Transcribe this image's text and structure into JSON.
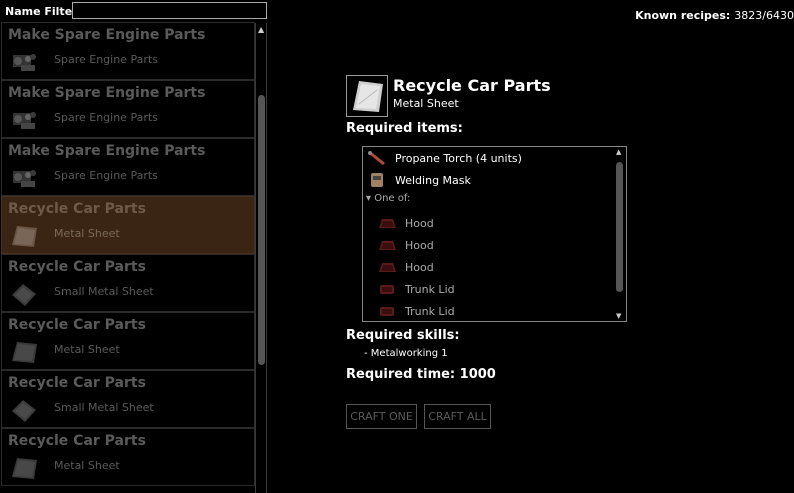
{
  "filter": {
    "label": "Name Filter:",
    "value": ""
  },
  "recipes": [
    {
      "title": "Make Spare Engine Parts",
      "result": "Spare Engine Parts",
      "icon": "engine-parts-icon",
      "selected": false
    },
    {
      "title": "Make Spare Engine Parts",
      "result": "Spare Engine Parts",
      "icon": "engine-parts-icon",
      "selected": false
    },
    {
      "title": "Make Spare Engine Parts",
      "result": "Spare Engine Parts",
      "icon": "engine-parts-icon",
      "selected": false
    },
    {
      "title": "Recycle Car Parts",
      "result": "Metal Sheet",
      "icon": "metal-sheet-icon",
      "selected": true
    },
    {
      "title": "Recycle Car Parts",
      "result": "Small Metal Sheet",
      "icon": "small-metal-sheet-icon",
      "selected": false
    },
    {
      "title": "Recycle Car Parts",
      "result": "Metal Sheet",
      "icon": "metal-sheet-icon",
      "selected": false
    },
    {
      "title": "Recycle Car Parts",
      "result": "Small Metal Sheet",
      "icon": "small-metal-sheet-icon",
      "selected": false
    },
    {
      "title": "Recycle Car Parts",
      "result": "Metal Sheet",
      "icon": "metal-sheet-icon",
      "selected": false
    }
  ],
  "known": {
    "label": "Known recipes:",
    "value": "3823/6430"
  },
  "detail": {
    "title": "Recycle Car Parts",
    "result": "Metal Sheet",
    "required_items_label": "Required items:",
    "items": [
      {
        "name": "Propane Torch (4 units)",
        "icon": "propane-torch-icon"
      },
      {
        "name": "Welding Mask",
        "icon": "welding-mask-icon"
      }
    ],
    "one_of_label": "One of:",
    "one_of_items": [
      {
        "name": "Hood",
        "icon": "hood-icon"
      },
      {
        "name": "Hood",
        "icon": "hood-icon"
      },
      {
        "name": "Hood",
        "icon": "hood-icon"
      },
      {
        "name": "Trunk Lid",
        "icon": "trunk-lid-icon"
      },
      {
        "name": "Trunk Lid",
        "icon": "trunk-lid-icon"
      }
    ],
    "required_skills_label": "Required skills:",
    "skill": "- Metalworking 1",
    "required_time_label": "Required time: 1000",
    "craft_one": "CRAFT ONE",
    "craft_all": "CRAFT ALL"
  },
  "colors": {
    "selected_bg": "#3a2414",
    "dim_text": "#5a5a5a"
  }
}
